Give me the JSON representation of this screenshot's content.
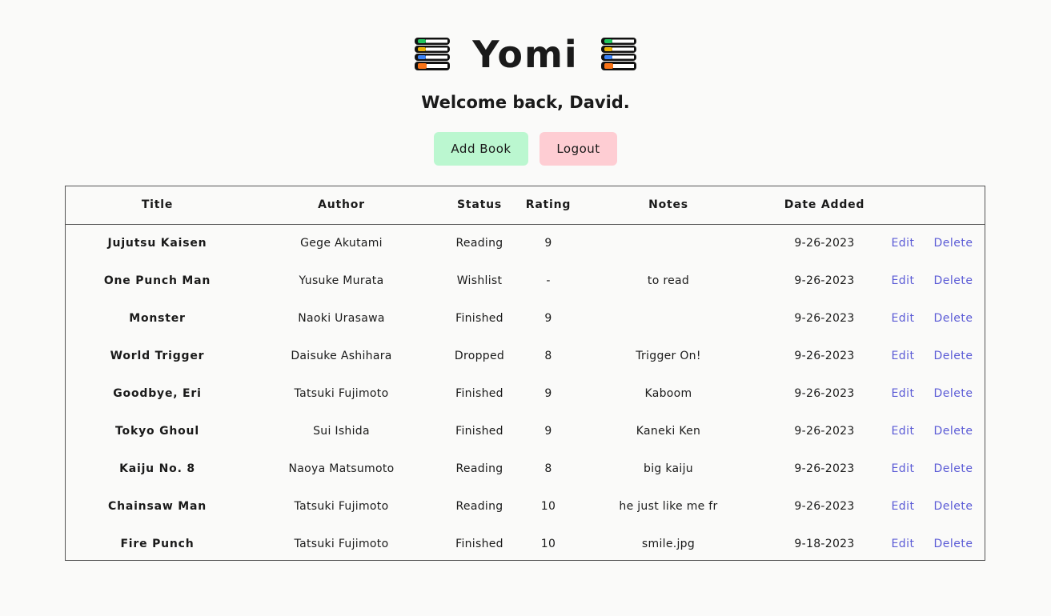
{
  "header": {
    "title": "Yomi",
    "left_icon": "books-stack-icon",
    "right_icon": "books-stack-icon"
  },
  "welcome_text": "Welcome back, David.",
  "actions": {
    "add_label": "Add Book",
    "logout_label": "Logout",
    "add_color": "#bbf7d0",
    "logout_color": "#fecdd3"
  },
  "table": {
    "columns": [
      "Title",
      "Author",
      "Status",
      "Rating",
      "Notes",
      "Date Added",
      "",
      ""
    ],
    "edit_label": "Edit",
    "delete_label": "Delete",
    "link_color": "#5b5bd6",
    "rows": [
      {
        "title": "Jujutsu Kaisen",
        "author": "Gege Akutami",
        "status": "Reading",
        "rating": "9",
        "notes": "",
        "date": "9-26-2023"
      },
      {
        "title": "One Punch Man",
        "author": "Yusuke Murata",
        "status": "Wishlist",
        "rating": "-",
        "notes": "to read",
        "date": "9-26-2023"
      },
      {
        "title": "Monster",
        "author": "Naoki Urasawa",
        "status": "Finished",
        "rating": "9",
        "notes": "",
        "date": "9-26-2023"
      },
      {
        "title": "World Trigger",
        "author": "Daisuke Ashihara",
        "status": "Dropped",
        "rating": "8",
        "notes": "Trigger On!",
        "date": "9-26-2023"
      },
      {
        "title": "Goodbye, Eri",
        "author": "Tatsuki Fujimoto",
        "status": "Finished",
        "rating": "9",
        "notes": "Kaboom",
        "date": "9-26-2023"
      },
      {
        "title": "Tokyo Ghoul",
        "author": "Sui Ishida",
        "status": "Finished",
        "rating": "9",
        "notes": "Kaneki Ken",
        "date": "9-26-2023"
      },
      {
        "title": "Kaiju No. 8",
        "author": "Naoya Matsumoto",
        "status": "Reading",
        "rating": "8",
        "notes": "big kaiju",
        "date": "9-26-2023"
      },
      {
        "title": "Chainsaw Man",
        "author": "Tatsuki Fujimoto",
        "status": "Reading",
        "rating": "10",
        "notes": "he just like me fr",
        "date": "9-26-2023"
      },
      {
        "title": "Fire Punch",
        "author": "Tatsuki Fujimoto",
        "status": "Finished",
        "rating": "10",
        "notes": "smile.jpg",
        "date": "9-18-2023"
      }
    ]
  }
}
